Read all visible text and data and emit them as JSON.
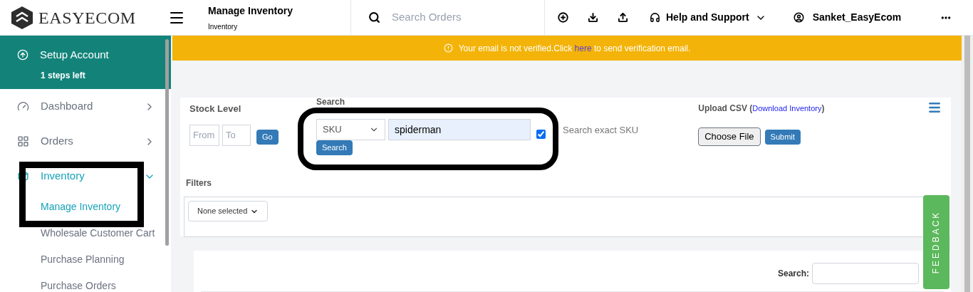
{
  "header": {
    "logo": "EASYECOM",
    "title": "Manage Inventory",
    "subtitle": "Inventory",
    "search": {
      "placeholder": "Search Orders"
    },
    "help": "Help and Support",
    "user": "Sanket_EasyEcom"
  },
  "sidebar": {
    "setup": {
      "title": "Setup Account",
      "subtitle": "1 steps left"
    },
    "items": [
      {
        "label": "Dashboard",
        "selected": false,
        "expanded": false
      },
      {
        "label": "Orders",
        "selected": false,
        "expanded": false
      },
      {
        "label": "Inventory",
        "selected": true,
        "expanded": true,
        "children": [
          {
            "label": "Manage Inventory",
            "selected": true
          },
          {
            "label": "Wholesale Customer Cart",
            "selected": false
          },
          {
            "label": "Purchase Planning",
            "selected": false
          },
          {
            "label": "Purchase Orders",
            "selected": false
          }
        ]
      }
    ]
  },
  "banner": {
    "before": "Your email is not verified.Click ",
    "link": "here",
    "after": " to send verification email."
  },
  "stock_level": {
    "label": "Stock Level",
    "from": {
      "placeholder": "From"
    },
    "to": {
      "placeholder": "To"
    },
    "button": "Go"
  },
  "search": {
    "label": "Search",
    "field": "SKU",
    "value": "spiderman",
    "button": "Search",
    "exact": {
      "label": "Search exact SKU",
      "checked": true
    }
  },
  "upload": {
    "label": "Upload CSV (",
    "link": "Download Inventory",
    "close": ")",
    "choose": "Choose File",
    "submit": "Submit"
  },
  "filters": {
    "label": "Filters",
    "dropdown": "None selected"
  },
  "table": {
    "search_label": "Search:"
  },
  "feedback": "FEEDBACK"
}
